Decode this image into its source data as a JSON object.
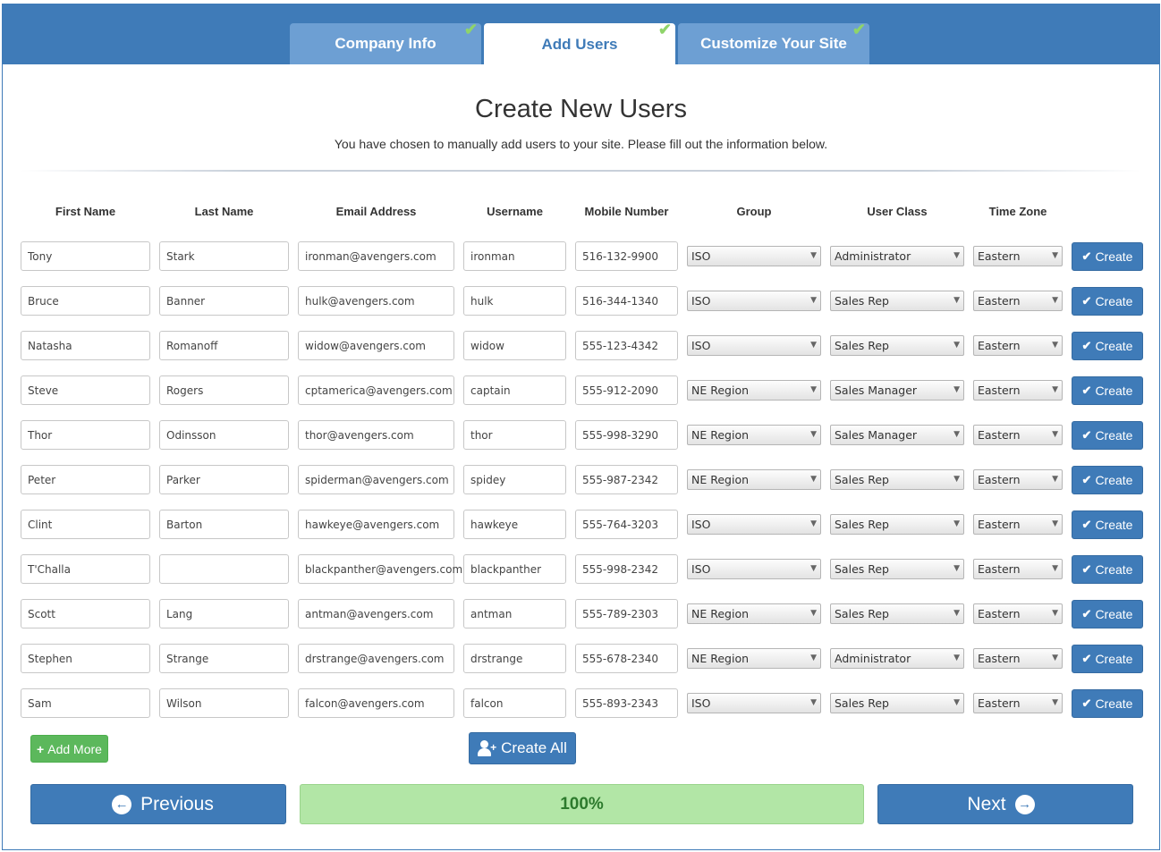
{
  "tabs": [
    {
      "label": "Company Info",
      "done": true
    },
    {
      "label": "Add Users",
      "done": true
    },
    {
      "label": "Customize Your Site",
      "done": true
    }
  ],
  "title": "Create New Users",
  "subtitle": "You have chosen to manually add users to your site. Please fill out the information below.",
  "columns": [
    "First Name",
    "Last Name",
    "Email Address",
    "Username",
    "Mobile Number",
    "Group",
    "User Class",
    "Time Zone"
  ],
  "create_label": "Create",
  "rows": [
    {
      "first": "Tony",
      "last": "Stark",
      "email": "ironman@avengers.com",
      "username": "ironman",
      "mobile": "516-132-9900",
      "group": "ISO",
      "user_class": "Administrator",
      "tz": "Eastern"
    },
    {
      "first": "Bruce",
      "last": "Banner",
      "email": "hulk@avengers.com",
      "username": "hulk",
      "mobile": "516-344-1340",
      "group": "ISO",
      "user_class": "Sales Rep",
      "tz": "Eastern"
    },
    {
      "first": "Natasha",
      "last": "Romanoff",
      "email": "widow@avengers.com",
      "username": "widow",
      "mobile": "555-123-4342",
      "group": "ISO",
      "user_class": "Sales Rep",
      "tz": "Eastern"
    },
    {
      "first": "Steve",
      "last": "Rogers",
      "email": "cptamerica@avengers.com",
      "username": "captain",
      "mobile": "555-912-2090",
      "group": "NE Region",
      "user_class": "Sales Manager",
      "tz": "Eastern"
    },
    {
      "first": "Thor",
      "last": "Odinsson",
      "email": "thor@avengers.com",
      "username": "thor",
      "mobile": "555-998-3290",
      "group": "NE Region",
      "user_class": "Sales Manager",
      "tz": "Eastern"
    },
    {
      "first": "Peter",
      "last": "Parker",
      "email": "spiderman@avengers.com",
      "username": "spidey",
      "mobile": "555-987-2342",
      "group": "NE Region",
      "user_class": "Sales Rep",
      "tz": "Eastern"
    },
    {
      "first": "Clint",
      "last": "Barton",
      "email": "hawkeye@avengers.com",
      "username": "hawkeye",
      "mobile": "555-764-3203",
      "group": "ISO",
      "user_class": "Sales Rep",
      "tz": "Eastern"
    },
    {
      "first": "T'Challa",
      "last": "",
      "email": "blackpanther@avengers.com",
      "username": "blackpanther",
      "mobile": "555-998-2342",
      "group": "ISO",
      "user_class": "Sales Rep",
      "tz": "Eastern"
    },
    {
      "first": "Scott",
      "last": "Lang",
      "email": "antman@avengers.com",
      "username": "antman",
      "mobile": "555-789-2303",
      "group": "NE Region",
      "user_class": "Sales Rep",
      "tz": "Eastern"
    },
    {
      "first": "Stephen",
      "last": "Strange",
      "email": "drstrange@avengers.com",
      "username": "drstrange",
      "mobile": "555-678-2340",
      "group": "NE Region",
      "user_class": "Administrator",
      "tz": "Eastern"
    },
    {
      "first": "Sam",
      "last": "Wilson",
      "email": "falcon@avengers.com",
      "username": "falcon",
      "mobile": "555-893-2343",
      "group": "ISO",
      "user_class": "Sales Rep",
      "tz": "Eastern"
    }
  ],
  "add_more_label": "Add More",
  "create_all_label": "Create All",
  "previous_label": "Previous",
  "next_label": "Next",
  "progress": {
    "value": 100,
    "label": "100%"
  },
  "colors": {
    "primary": "#3f7bb8",
    "tab_inactive": "#6d9fd3",
    "success": "#5cb85c",
    "progress": "#b2e6a6",
    "check": "#8fd46a"
  }
}
